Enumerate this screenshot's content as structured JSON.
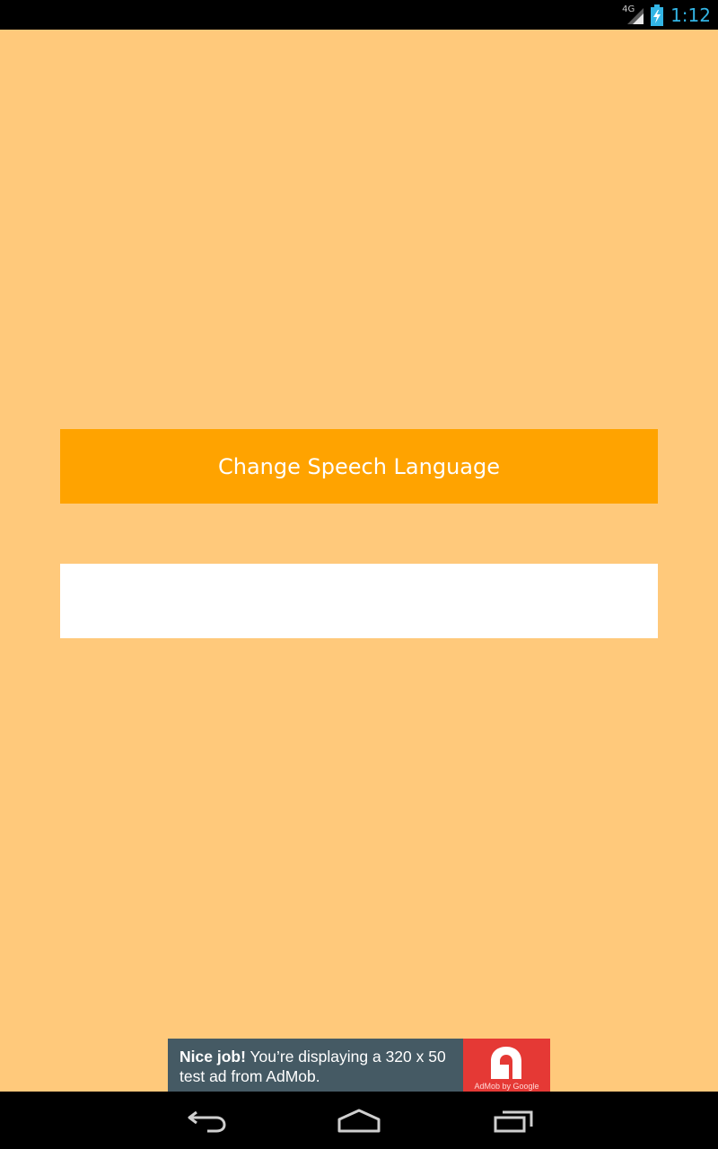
{
  "status_bar": {
    "network_type": "4G",
    "time": "1:12",
    "icons": [
      "signal-icon",
      "battery-charging-icon"
    ]
  },
  "main": {
    "change_language_button": "Change Speech Language",
    "result_box_text": ""
  },
  "ad": {
    "bold_text": "Nice job!",
    "body_text": " You’re displaying a 320 x 50 test ad from AdMob.",
    "logo_caption": "AdMob by Google"
  },
  "nav_bar": {
    "icons": [
      "back-icon",
      "home-icon",
      "recents-icon"
    ]
  },
  "colors": {
    "background": "#ffc97b",
    "button": "#ffa300",
    "ad_background": "#455a64",
    "ad_logo": "#e53935",
    "clock": "#33b5e5"
  }
}
